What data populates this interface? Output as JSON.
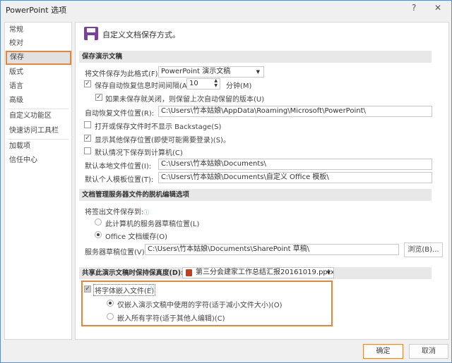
{
  "window": {
    "title": "PowerPoint 选项",
    "help": "?",
    "close": "✕"
  },
  "sidebar": {
    "items": [
      {
        "label": "常规"
      },
      {
        "label": "校对"
      },
      {
        "label": "保存"
      },
      {
        "label": "版式"
      },
      {
        "label": "语言"
      },
      {
        "label": "高级"
      },
      {
        "label": "自定义功能区"
      },
      {
        "label": "快速访问工具栏"
      },
      {
        "label": "加载项"
      },
      {
        "label": "信任中心"
      }
    ],
    "selected": "保存"
  },
  "header": {
    "title": "自定义文档保存方式。",
    "icon": "floppy-disk-icon",
    "icon_color": "#7b3fa0"
  },
  "save_section": {
    "title": "保存演示文稿",
    "format_label": "将文件保存为此格式(F):",
    "format_value": "PowerPoint 演示文稿",
    "autorecover_label": "保存自动恢复信息时间间隔(A)",
    "autorecover_checked": true,
    "autorecover_minutes": "10",
    "minutes_label": "分钟(M)",
    "keep_last_label": "如果未保存就关闭，则保留上次自动保留的版本(U)",
    "keep_last_checked": true,
    "autorecover_location_label": "自动恢复文件位置(R):",
    "autorecover_location": "C:\\Users\\竹本姑娘\\AppData\\Roaming\\Microsoft\\PowerPoint\\",
    "no_backstage_label": "打开或保存文件时不显示 Backstage(S)",
    "no_backstage_checked": false,
    "show_additional_label": "显示其他保存位置(即使可能需要登录)(S)。",
    "show_additional_checked": true,
    "save_to_computer_label": "默认情况下保存到计算机(C)",
    "save_to_computer_checked": false,
    "local_location_label": "默认本地文件位置(I):",
    "local_location": "C:\\Users\\竹本姑娘\\Documents\\",
    "template_location_label": "默认个人模板位置(T):",
    "template_location": "C:\\Users\\竹本姑娘\\Documents\\自定义 Office 模板\\"
  },
  "offline_section": {
    "title": "文档管理服务器文件的脱机编辑选项",
    "save_checked_out_label": "将签出文件保存到:",
    "option_server": "此计算机的服务器草稿位置(L)",
    "option_cache": "Office 文档缓存(O)",
    "selected": "Office 文档缓存(O)",
    "drafts_label": "服务器草稿位置(V):",
    "drafts_location": "C:\\Users\\竹本姑娘\\Documents\\SharePoint 草稿\\",
    "browse": "浏览(B)..."
  },
  "fidelity_section": {
    "title": "共享此演示文稿时保持保真度(D):",
    "file": "第三分会建家工作总结汇报20161019.pptx",
    "embed_label": "将字体嵌入文件(E)",
    "embed_checked": true,
    "option_used": "仅嵌入演示文稿中使用的字符(适于减小文件大小)(O)",
    "option_all": "嵌入所有字符(适于其他人编辑)(C)",
    "selected": "仅嵌入演示文稿中使用的字符(适于减小文件大小)(O)"
  },
  "footer": {
    "ok": "确定",
    "cancel": "取消"
  },
  "colors": {
    "accent": "#e9853a",
    "ppt": "#c43e1c"
  }
}
